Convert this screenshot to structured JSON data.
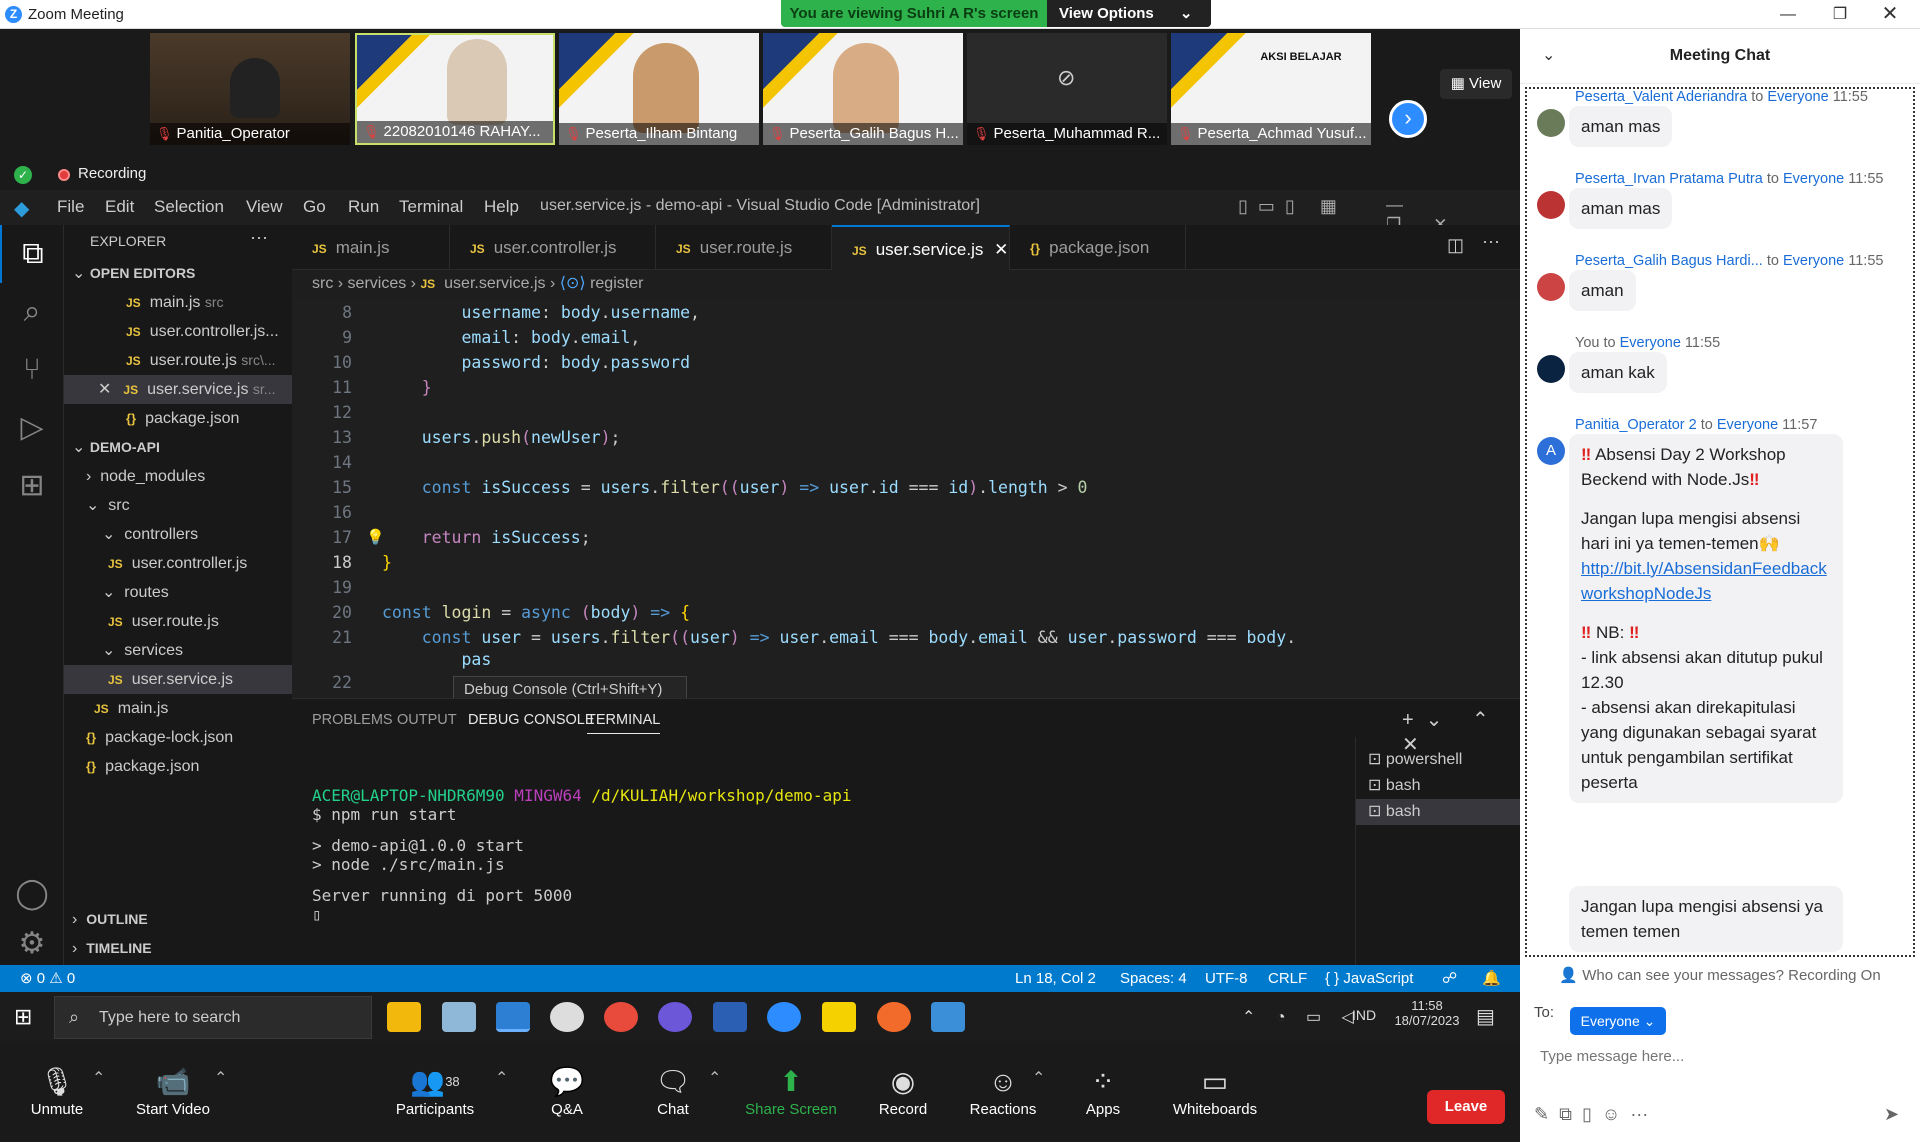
{
  "zoom_title": "Zoom Meeting",
  "banner": {
    "text": "You are viewing Suhri A R's screen",
    "options": "View Options"
  },
  "participants_tiles": [
    {
      "name": "Panitia_Operator"
    },
    {
      "name": "22082010146 RAHAY..."
    },
    {
      "name": "Peserta_Ilham Bintang"
    },
    {
      "name": "Peserta_Galih Bagus H..."
    },
    {
      "name": "Peserta_Muhammad R..."
    },
    {
      "name": "Peserta_Achmad Yusuf..."
    }
  ],
  "tile_banner_text": "AKSI BELAJAR",
  "view_label": "View",
  "recording": "Recording",
  "vscode": {
    "menu": [
      "File",
      "Edit",
      "Selection",
      "View",
      "Go",
      "Run",
      "Terminal",
      "Help"
    ],
    "title": "user.service.js - demo-api - Visual Studio Code [Administrator]",
    "explorer": "EXPLORER",
    "open_editors_label": "OPEN EDITORS",
    "open_editors": [
      {
        "name": "main.js",
        "hint": "src"
      },
      {
        "name": "user.controller.js...",
        "hint": ""
      },
      {
        "name": "user.route.js",
        "hint": "src\\..."
      },
      {
        "name": "user.service.js",
        "hint": "sr..."
      },
      {
        "name": "package.json",
        "hint": ""
      }
    ],
    "project_label": "DEMO-API",
    "tree": [
      "node_modules",
      "src",
      "controllers",
      "user.controller.js",
      "routes",
      "user.route.js",
      "services",
      "user.service.js",
      "main.js",
      "package-lock.json",
      "package.json"
    ],
    "outline": "OUTLINE",
    "timeline": "TIMELINE",
    "tabs": [
      "main.js",
      "user.controller.js",
      "user.route.js",
      "user.service.js",
      "package.json"
    ],
    "breadcrumb": [
      "src",
      "services",
      "user.service.js",
      "register"
    ],
    "line_numbers": [
      "8",
      "9",
      "10",
      "11",
      "12",
      "13",
      "14",
      "15",
      "16",
      "17",
      "18",
      "19",
      "20",
      "21",
      "22"
    ],
    "hint": "Debug Console (Ctrl+Shift+Y)",
    "panel_tabs": [
      "PROBLEMS",
      "OUTPUT",
      "DEBUG CONSOLE",
      "TERMINAL"
    ],
    "terminal": {
      "user": "ACER@LAPTOP-NHDR6M90",
      "env": "MINGW64",
      "path": "/d/KULIAH/workshop/demo-api",
      "cmd": "$ npm run start",
      "l1": "> demo-api@1.0.0 start",
      "l2": "> node ./src/main.js",
      "l3": "Server running di port 5000"
    },
    "terminal_list": [
      "powershell",
      "bash",
      "bash"
    ],
    "status": {
      "problems": "⊗ 0 ⚠ 0",
      "position": "Ln 18, Col 2",
      "spaces": "Spaces: 4",
      "encoding": "UTF-8",
      "eol": "CRLF",
      "language": "{ } JavaScript"
    }
  },
  "taskbar": {
    "search": "Type here to search",
    "lang": "IND",
    "time": "11:58",
    "date": "18/07/2023"
  },
  "controls": {
    "unmute": "Unmute",
    "video": "Start Video",
    "participants": "Participants",
    "participants_count": "38",
    "qa": "Q&A",
    "chat": "Chat",
    "share": "Share Screen",
    "record": "Record",
    "reactions": "Reactions",
    "apps": "Apps",
    "whiteboards": "Whiteboards",
    "leave": "Leave"
  },
  "chat": {
    "title": "Meeting Chat",
    "messages": [
      {
        "from": "Peserta_Valent Aderiandra",
        "to": "Everyone",
        "time": "11:55",
        "text": "aman mas"
      },
      {
        "from": "Peserta_Irvan Pratama Putra",
        "to": "Everyone",
        "time": "11:55",
        "text": "aman mas"
      },
      {
        "from": "Peserta_Galih Bagus Hardi...",
        "to": "Everyone",
        "time": "11:55",
        "text": "aman"
      },
      {
        "from": "You",
        "to": "Everyone",
        "time": "11:55",
        "text": "aman kak"
      },
      {
        "from": "Panitia_Operator 2",
        "to": "Everyone",
        "time": "11:57"
      }
    ],
    "to_word": "to",
    "announce": {
      "title": "Absensi Day 2 Workshop Beckend with Node.Js",
      "body1": "Jangan lupa mengisi absensi hari ini ya temen-temen",
      "link": "http://bit.ly/AbsensidanFeedbackworkshopNodeJs",
      "nb": "NB:",
      "nb1": "- link absensi akan ditutup pukul 12.30",
      "nb2": "- absensi akan direkapitulasi yang digunakan sebagai syarat untuk pengambilan sertifikat peserta"
    },
    "followup": "Jangan lupa mengisi absensi ya temen temen",
    "who_can_see": "Who can see your messages? Recording On",
    "to_label": "To:",
    "recipient": "Everyone",
    "placeholder": "Type message here..."
  }
}
